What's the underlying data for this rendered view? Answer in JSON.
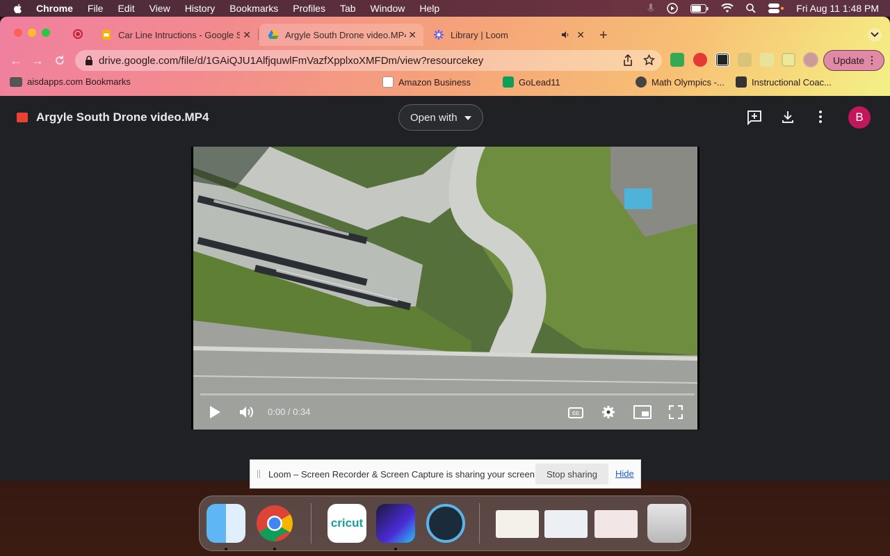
{
  "menubar": {
    "app": "Chrome",
    "items": [
      "File",
      "Edit",
      "View",
      "History",
      "Bookmarks",
      "Profiles",
      "Tab",
      "Window",
      "Help"
    ],
    "clock": "Fri Aug 11  1:48 PM"
  },
  "tabs": [
    {
      "title": "Car Line Intructions - Google S",
      "favicon": "google-slides-icon"
    },
    {
      "title": "Argyle South Drone video.MP4",
      "favicon": "google-drive-icon",
      "active": true
    },
    {
      "title": "Library | Loom",
      "favicon": "loom-icon"
    }
  ],
  "omnibox": {
    "url": "drive.google.com/file/d/1GAiQJU1AlfjquwlFmVazfXpplxoXMFDm/view?resourcekey"
  },
  "update_label": "Update",
  "bookmarks": {
    "folder": "aisdapps.com Bookmarks",
    "amazon": "Amazon Business",
    "golead": "GoLead11",
    "math": "Math Olympics -...",
    "coach": "Instructional Coac..."
  },
  "viewer": {
    "file_title": "Argyle South Drone video.MP4",
    "open_with": "Open with",
    "account_initial": "B"
  },
  "video": {
    "time": "0:00 / 0:34",
    "progress": 0
  },
  "loom_banner": {
    "message": "Loom – Screen Recorder & Screen Capture is sharing your screen.",
    "stop": "Stop sharing",
    "hide": "Hide"
  },
  "dock": {
    "cricut_label": "cricut"
  },
  "colors": {
    "drive_bg": "#202124",
    "account": "#c2185b",
    "loom_link": "#1a5fd0"
  }
}
